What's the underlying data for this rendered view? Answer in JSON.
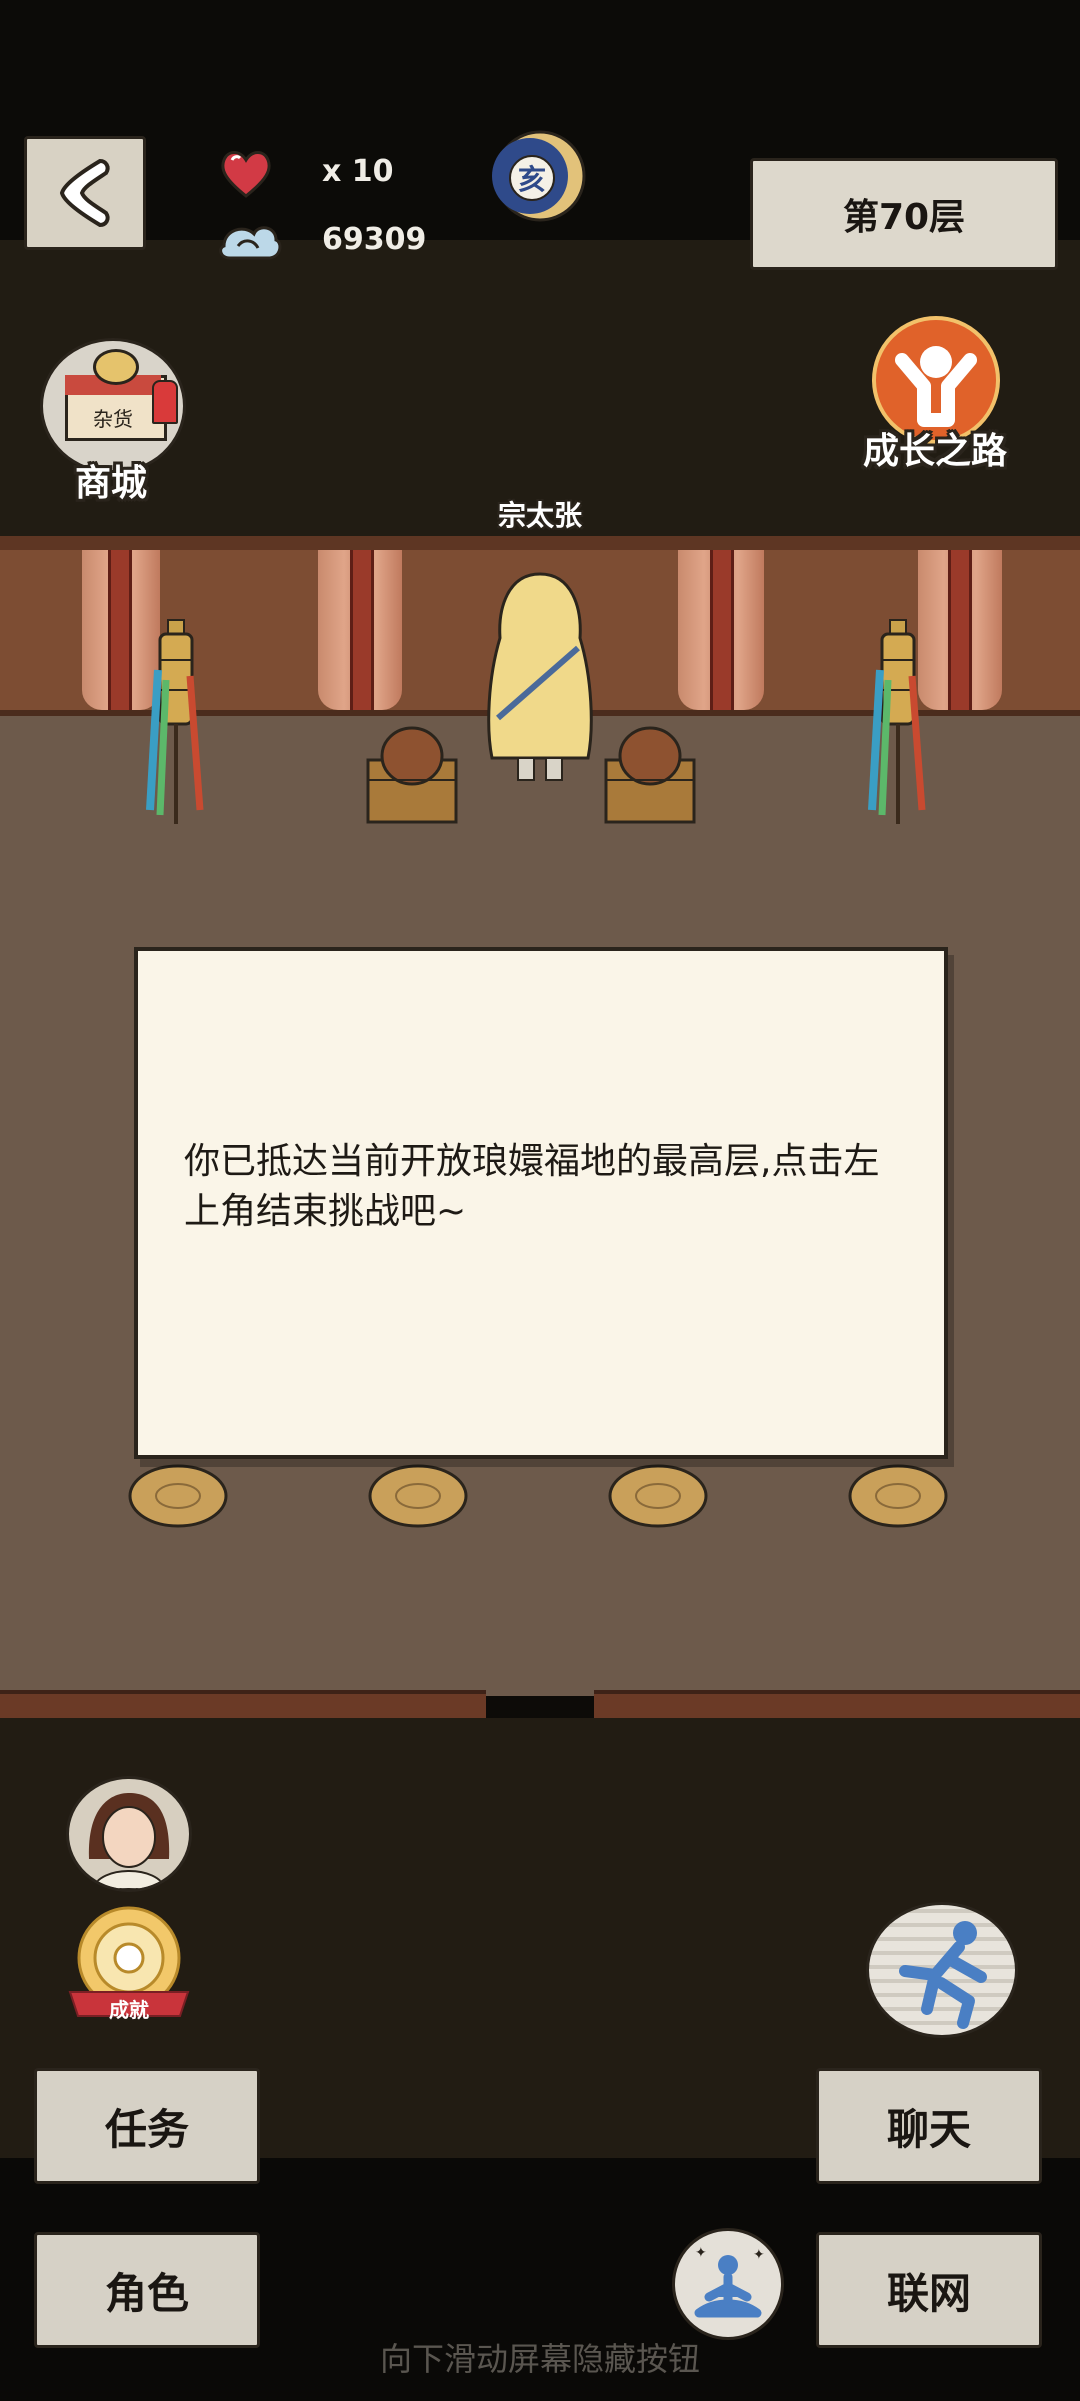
{
  "header": {
    "lives_count": "x 10",
    "currency_amount": "69309",
    "moon_badge_char": "亥",
    "floor_label": "第70层"
  },
  "shortcuts": {
    "shop_label": "商城",
    "shop_sign": "杂货",
    "growth_label": "成长之路",
    "achievement_label": "成就"
  },
  "scene": {
    "npc_name": "宗太张"
  },
  "dialog": {
    "message": "你已抵达当前开放琅嬛福地的最高层,点击左上角结束挑战吧~"
  },
  "buttons": {
    "task": "任务",
    "role": "角色",
    "chat": "聊天",
    "network": "联网"
  },
  "hint": "向下滑动屏幕隐藏按钮",
  "colors": {
    "accent_red": "#c9343b",
    "moon_blue": "#2f4a8a",
    "growth_orange": "#e0622a"
  }
}
